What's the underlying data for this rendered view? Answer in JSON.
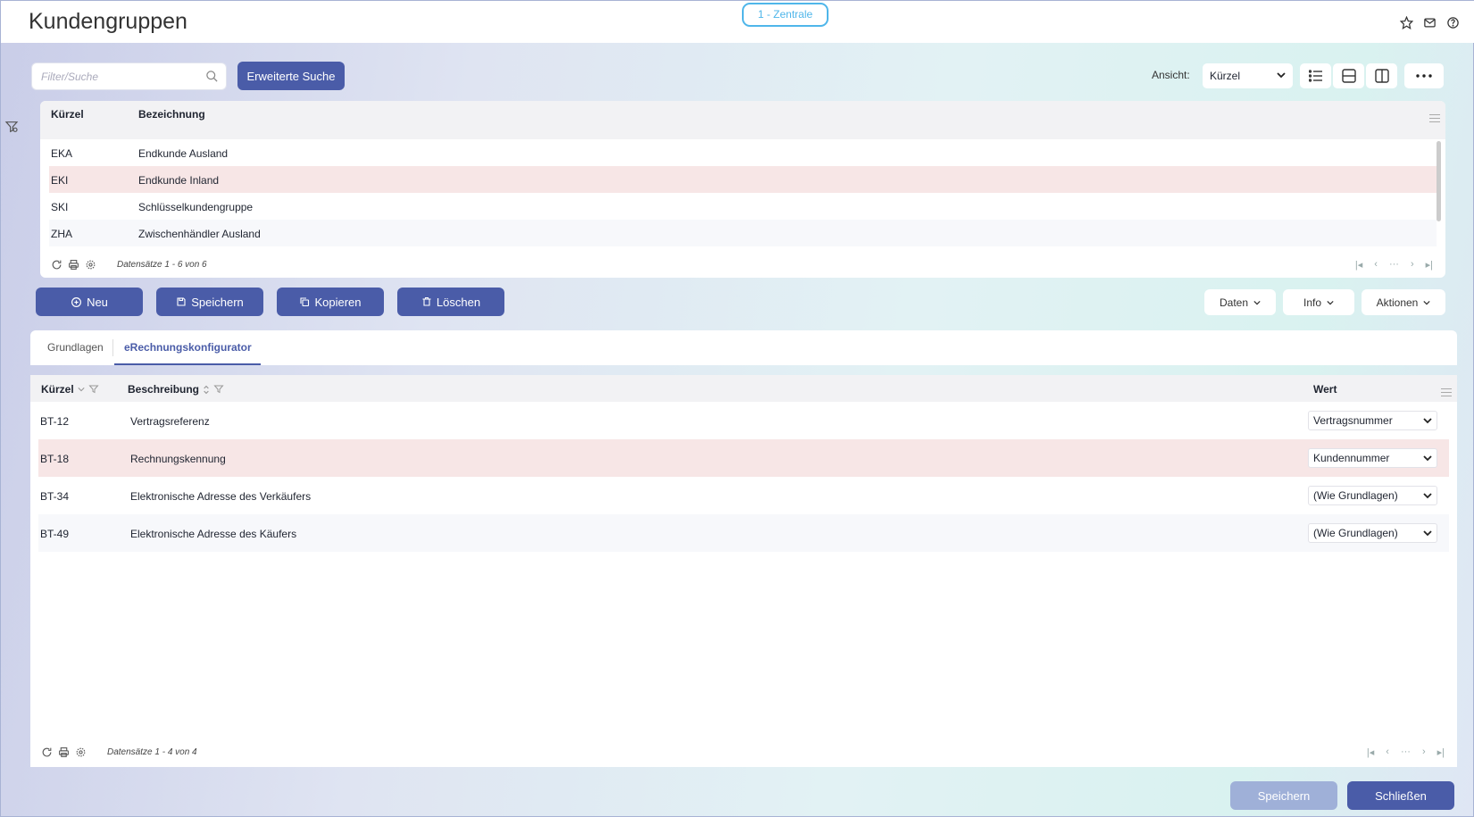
{
  "header": {
    "title": "Kundengruppen",
    "branch": "1 - Zentrale",
    "icons": [
      "star-icon",
      "mail-icon",
      "help-icon"
    ]
  },
  "toolbar": {
    "search_placeholder": "Filter/Suche",
    "search_value": "",
    "advanced_search_label": "Erweiterte Suche",
    "view_label": "Ansicht:",
    "view_selected": "Kürzel"
  },
  "master_table": {
    "columns": [
      "Kürzel",
      "Bezeichnung"
    ],
    "rows": [
      {
        "code": "EKA",
        "name": "Endkunde Ausland"
      },
      {
        "code": "EKI",
        "name": "Endkunde Inland"
      },
      {
        "code": "SKI",
        "name": "Schlüsselkundengruppe"
      },
      {
        "code": "ZHA",
        "name": "Zwischenhändler Ausland"
      }
    ],
    "selected_row": 1,
    "record_count": "Datensätze 1 - 6 von 6"
  },
  "actions": {
    "new": "Neu",
    "save": "Speichern",
    "copy": "Kopieren",
    "delete": "Löschen",
    "data_menu": "Daten",
    "info_menu": "Info",
    "actions_menu": "Aktionen"
  },
  "tabs": [
    {
      "label": "Grundlagen",
      "active": false
    },
    {
      "label": "eRechnungskonfigurator",
      "active": true
    }
  ],
  "detail_table": {
    "columns": [
      "Kürzel",
      "Beschreibung",
      "Wert"
    ],
    "rows": [
      {
        "code": "BT-12",
        "desc": "Vertragsreferenz",
        "value": "Vertragsnummer"
      },
      {
        "code": "BT-18",
        "desc": "Rechnungskennung",
        "value": "Kundennummer"
      },
      {
        "code": "BT-34",
        "desc": "Elektronische Adresse des Verkäufers",
        "value": "(Wie Grundlagen)"
      },
      {
        "code": "BT-49",
        "desc": "Elektronische Adresse des Käufers",
        "value": "(Wie Grundlagen)"
      }
    ],
    "selected_row": 1,
    "record_count": "Datensätze 1 - 4 von 4"
  },
  "footer": {
    "save": "Speichern",
    "close": "Schließen"
  },
  "colors": {
    "primary": "#4a5ca8",
    "selected_row": "#f7e6e6",
    "branch_accent": "#4fb6ea"
  }
}
